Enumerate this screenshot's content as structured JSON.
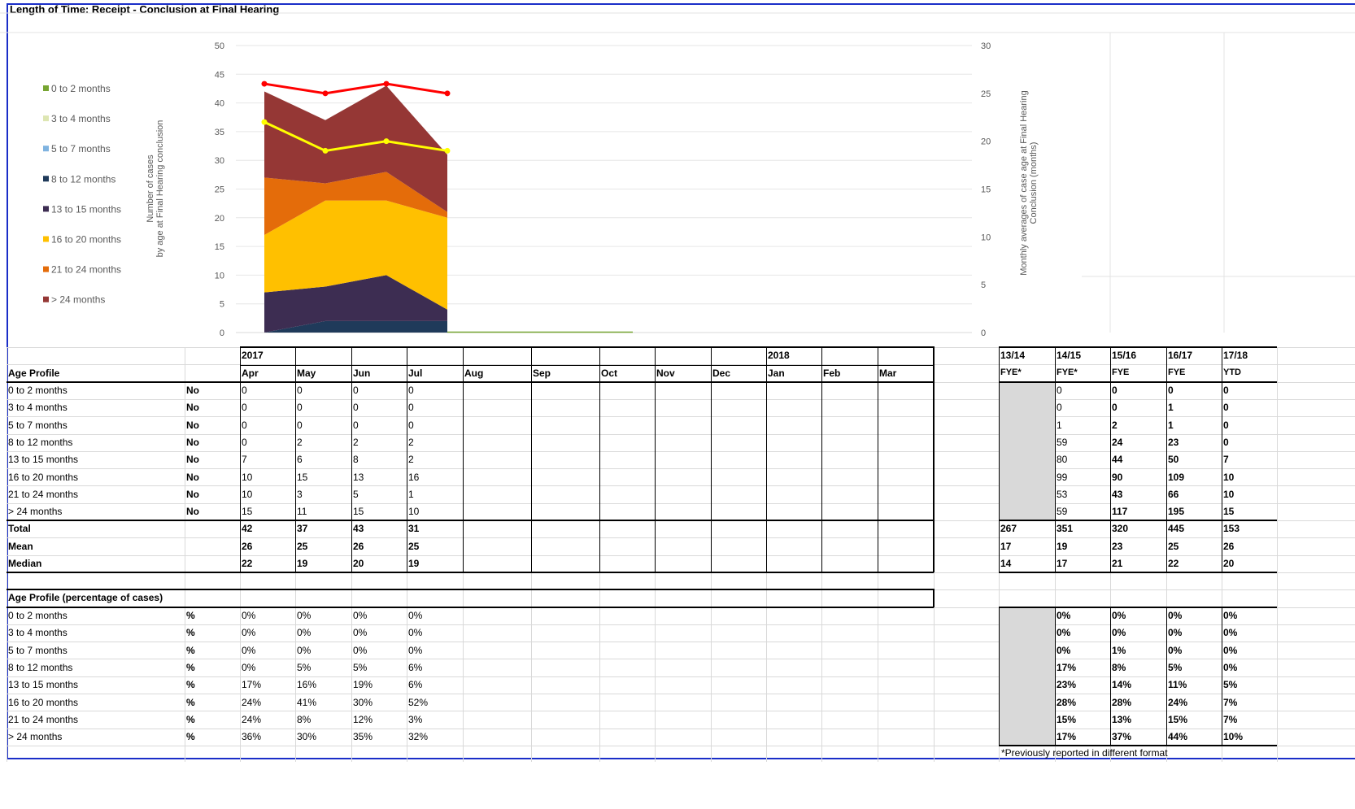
{
  "title": "Length of Time: Receipt - Conclusion at Final Hearing",
  "chart_data": {
    "type": "area",
    "categories": [
      "Apr",
      "May",
      "Jun",
      "Jul"
    ],
    "series": [
      {
        "name": "0 to 2 months",
        "values": [
          0,
          0,
          0,
          0
        ],
        "color": "#77a532"
      },
      {
        "name": "3 to 4 months",
        "values": [
          0,
          0,
          0,
          0
        ],
        "color": "#dde6b2"
      },
      {
        "name": "5 to 7 months",
        "values": [
          0,
          0,
          0,
          0
        ],
        "color": "#7fb3e0"
      },
      {
        "name": "8 to 12 months",
        "values": [
          0,
          2,
          2,
          2
        ],
        "color": "#1f3a5a"
      },
      {
        "name": "13 to 15 months",
        "values": [
          7,
          6,
          8,
          2
        ],
        "color": "#3d2d52"
      },
      {
        "name": "16 to 20 months",
        "values": [
          10,
          15,
          13,
          16
        ],
        "color": "#ffc000"
      },
      {
        "name": "21 to 24 months",
        "values": [
          10,
          3,
          5,
          1
        ],
        "color": "#e46c0a"
      },
      {
        "name": "> 24 months",
        "values": [
          15,
          11,
          15,
          10
        ],
        "color": "#953735"
      }
    ],
    "lines": [
      {
        "name": "Mean",
        "values": [
          26,
          25,
          26,
          25
        ],
        "color": "#ff0000",
        "axis": "right"
      },
      {
        "name": "Median",
        "values": [
          22,
          19,
          20,
          19
        ],
        "color": "#ffff00",
        "axis": "right"
      }
    ],
    "ylabel": "Number of cases by age at Final Hearing conclusion",
    "ylabel_lines": [
      "Number of cases",
      "by age at Final Hearing conclusion"
    ],
    "y2label": "Monthly averages of case age at Final Hearing Conclusion (months)",
    "y2label_lines": [
      "Monthly averages of case age at Final Hearing",
      "Conclusion (months)"
    ],
    "ylim": [
      0,
      50
    ],
    "y2lim": [
      0,
      30
    ],
    "yticks": [
      "0",
      "5",
      "10",
      "15",
      "20",
      "25",
      "30",
      "35",
      "40",
      "45",
      "50"
    ],
    "y2ticks": [
      "0",
      "5",
      "10",
      "15",
      "20",
      "25",
      "30"
    ],
    "legend_position": "left"
  },
  "table": {
    "year_labels": [
      "2017",
      "2018"
    ],
    "section1_label": "Age Profile",
    "months": [
      "Apr",
      "May",
      "Jun",
      "Jul",
      "Aug",
      "Sep",
      "Oct",
      "Nov",
      "Dec",
      "Jan",
      "Feb",
      "Mar"
    ],
    "fy_top": [
      "13/14",
      "14/15",
      "15/16",
      "16/17",
      "17/18"
    ],
    "fy_sub": [
      "FYE*",
      "FYE*",
      "FYE",
      "FYE",
      "YTD"
    ],
    "rows": [
      {
        "label": "0 to 2 months",
        "unit": "No",
        "months": [
          "0",
          "0",
          "0",
          "0"
        ],
        "fy": [
          "",
          "0",
          "0",
          "0",
          "0"
        ]
      },
      {
        "label": "3 to 4 months",
        "unit": "No",
        "months": [
          "0",
          "0",
          "0",
          "0"
        ],
        "fy": [
          "",
          "0",
          "0",
          "1",
          "0"
        ]
      },
      {
        "label": "5 to 7 months",
        "unit": "No",
        "months": [
          "0",
          "0",
          "0",
          "0"
        ],
        "fy": [
          "",
          "1",
          "2",
          "1",
          "0"
        ]
      },
      {
        "label": "8 to 12 months",
        "unit": "No",
        "months": [
          "0",
          "2",
          "2",
          "2"
        ],
        "fy": [
          "",
          "59",
          "24",
          "23",
          "0"
        ]
      },
      {
        "label": "13 to 15 months",
        "unit": "No",
        "months": [
          "7",
          "6",
          "8",
          "2"
        ],
        "fy": [
          "",
          "80",
          "44",
          "50",
          "7"
        ]
      },
      {
        "label": "16 to 20 months",
        "unit": "No",
        "months": [
          "10",
          "15",
          "13",
          "16"
        ],
        "fy": [
          "",
          "99",
          "90",
          "109",
          "10"
        ]
      },
      {
        "label": "21 to 24 months",
        "unit": "No",
        "months": [
          "10",
          "3",
          "5",
          "1"
        ],
        "fy": [
          "",
          "53",
          "43",
          "66",
          "10"
        ]
      },
      {
        "label": "> 24 months",
        "unit": "No",
        "months": [
          "15",
          "11",
          "15",
          "10"
        ],
        "fy": [
          "",
          "59",
          "117",
          "195",
          "15"
        ]
      }
    ],
    "totals": [
      {
        "label": "Total",
        "months": [
          "42",
          "37",
          "43",
          "31"
        ],
        "fy": [
          "267",
          "351",
          "320",
          "445",
          "153"
        ]
      },
      {
        "label": "Mean",
        "months": [
          "26",
          "25",
          "26",
          "25"
        ],
        "fy": [
          "17",
          "19",
          "23",
          "25",
          "26"
        ]
      },
      {
        "label": "Median",
        "months": [
          "22",
          "19",
          "20",
          "19"
        ],
        "fy": [
          "14",
          "17",
          "21",
          "22",
          "20"
        ]
      }
    ],
    "section2_label": "Age Profile (percentage of cases)",
    "pct_rows": [
      {
        "label": "0 to 2 months",
        "unit": "%",
        "months": [
          "0%",
          "0%",
          "0%",
          "0%"
        ],
        "fy": [
          "",
          "0%",
          "0%",
          "0%",
          "0%"
        ]
      },
      {
        "label": "3 to 4 months",
        "unit": "%",
        "months": [
          "0%",
          "0%",
          "0%",
          "0%"
        ],
        "fy": [
          "",
          "0%",
          "0%",
          "0%",
          "0%"
        ]
      },
      {
        "label": "5 to 7 months",
        "unit": "%",
        "months": [
          "0%",
          "0%",
          "0%",
          "0%"
        ],
        "fy": [
          "",
          "0%",
          "1%",
          "0%",
          "0%"
        ]
      },
      {
        "label": "8 to 12 months",
        "unit": "%",
        "months": [
          "0%",
          "5%",
          "5%",
          "6%"
        ],
        "fy": [
          "",
          "17%",
          "8%",
          "5%",
          "0%"
        ]
      },
      {
        "label": "13 to 15 months",
        "unit": "%",
        "months": [
          "17%",
          "16%",
          "19%",
          "6%"
        ],
        "fy": [
          "",
          "23%",
          "14%",
          "11%",
          "5%"
        ]
      },
      {
        "label": "16 to 20 months",
        "unit": "%",
        "months": [
          "24%",
          "41%",
          "30%",
          "52%"
        ],
        "fy": [
          "",
          "28%",
          "28%",
          "24%",
          "7%"
        ]
      },
      {
        "label": "21 to 24 months",
        "unit": "%",
        "months": [
          "24%",
          "8%",
          "12%",
          "3%"
        ],
        "fy": [
          "",
          "15%",
          "13%",
          "15%",
          "7%"
        ]
      },
      {
        "label": "> 24 months",
        "unit": "%",
        "months": [
          "36%",
          "30%",
          "35%",
          "32%"
        ],
        "fy": [
          "",
          "17%",
          "37%",
          "44%",
          "10%"
        ]
      }
    ],
    "footnote": "*Previously reported in different format"
  }
}
